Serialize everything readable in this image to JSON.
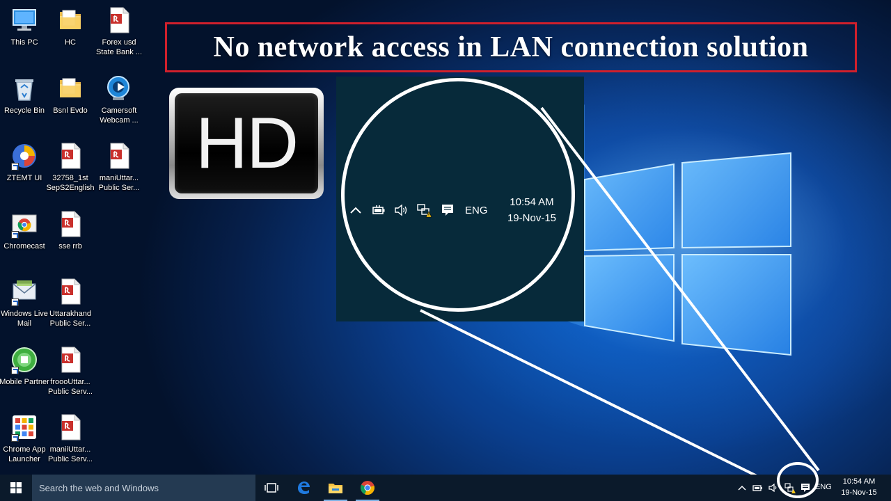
{
  "banner": {
    "title": "No network access in LAN connection solution"
  },
  "badge": {
    "label": "HD"
  },
  "desktop_icons": [
    {
      "label": "This PC",
      "icon": "pc-icon"
    },
    {
      "label": "HC",
      "icon": "folder-icon"
    },
    {
      "label": "Forex usd State Bank ...",
      "icon": "pdf-document-icon"
    },
    {
      "label": "Recycle Bin",
      "icon": "recycle-bin-icon"
    },
    {
      "label": "Bsnl Evdo",
      "icon": "folder-icon"
    },
    {
      "label": "Camersoft Webcam ...",
      "icon": "webcam-icon"
    },
    {
      "label": "ZTEMT UI",
      "icon": "app-swirl-icon"
    },
    {
      "label": "32758_1st SepS2English",
      "icon": "pdf-document-icon"
    },
    {
      "label": "maniUttar... Public Ser...",
      "icon": "pdf-document-icon"
    },
    {
      "label": "Chromecast",
      "icon": "chromecast-icon"
    },
    {
      "label": "sse rrb",
      "icon": "pdf-document-icon"
    },
    {
      "label": "Windows Live Mail",
      "icon": "mail-icon"
    },
    {
      "label": "Uttarakhand Public Ser...",
      "icon": "pdf-document-icon"
    },
    {
      "label": "Mobile Partner",
      "icon": "mobile-partner-icon"
    },
    {
      "label": "froooUttar... Public Serv...",
      "icon": "pdf-document-icon"
    },
    {
      "label": "Chrome App Launcher",
      "icon": "app-launcher-icon"
    },
    {
      "label": "maniiUttar... Public Serv...",
      "icon": "pdf-document-icon"
    }
  ],
  "zoom": {
    "language": "ENG",
    "time": "10:54 AM",
    "date": "19-Nov-15",
    "icons": [
      "chevron-up-icon",
      "battery-icon",
      "volume-icon",
      "network-warning-icon",
      "action-center-icon"
    ]
  },
  "taskbar": {
    "search_placeholder": "Search the web and Windows",
    "apps": [
      "task-view-icon",
      "edge-icon",
      "file-explorer-icon",
      "chrome-icon"
    ],
    "language": "ENG",
    "time": "10:54 AM",
    "date": "19-Nov-15"
  },
  "colors": {
    "banner_border": "#d0202c",
    "taskbar": "#0b1a2b",
    "search_box": "#243a52",
    "zoom_panel": "#072a3a",
    "accent_blue": "#1f7ae0"
  }
}
